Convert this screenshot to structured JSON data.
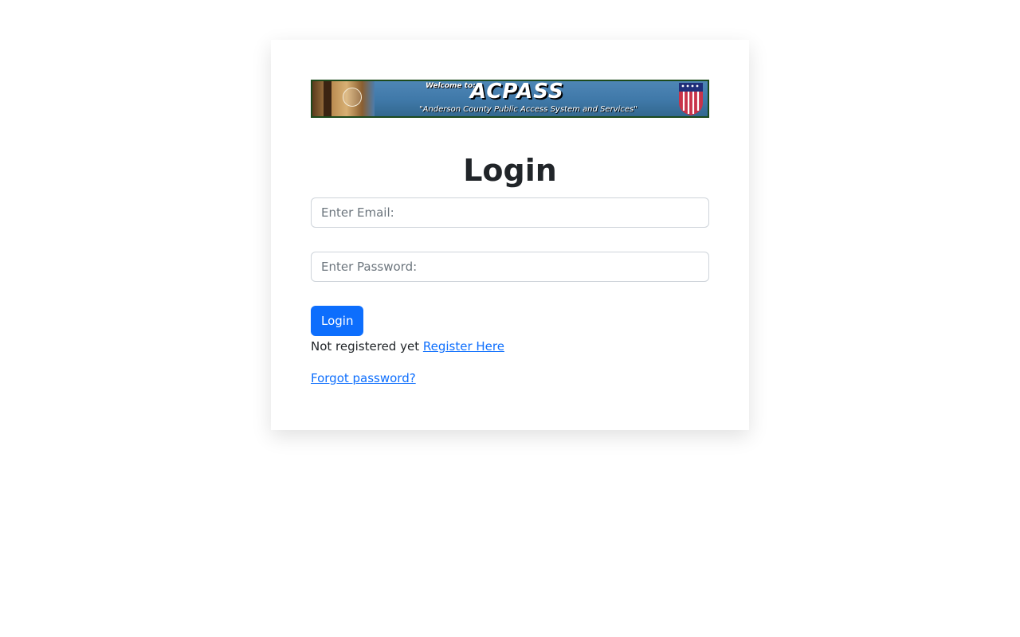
{
  "banner": {
    "welcome": "Welcome to:",
    "title": "ACPASS",
    "subtitle": "\"Anderson County Public Access System and Services\""
  },
  "login": {
    "heading": "Login",
    "email_placeholder": "Enter Email:",
    "password_placeholder": "Enter Password:",
    "button_label": "Login",
    "register_prompt": "Not registered yet",
    "register_link": "Register Here",
    "forgot_link": "Forgot password?"
  },
  "colors": {
    "accent": "#0d6efd",
    "text": "#212529",
    "banner_blue": "#3f78a8"
  }
}
